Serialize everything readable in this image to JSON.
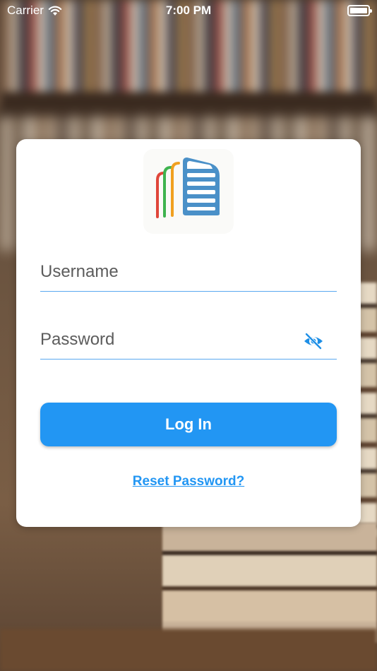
{
  "status_bar": {
    "carrier": "Carrier",
    "time": "7:00 PM"
  },
  "login": {
    "username_placeholder": "Username",
    "password_placeholder": "Password",
    "login_label": "Log In",
    "reset_label": "Reset Password?"
  },
  "icons": {
    "wifi": "wifi-icon",
    "battery": "battery-icon",
    "logo": "books-logo-icon",
    "visibility": "eye-off-icon"
  },
  "colors": {
    "accent": "#2296f3",
    "field_underline": "#5aa9f0",
    "logo_red": "#e0463a",
    "logo_green": "#3eb34f",
    "logo_orange": "#f0a020",
    "logo_blue": "#4a90c8"
  }
}
